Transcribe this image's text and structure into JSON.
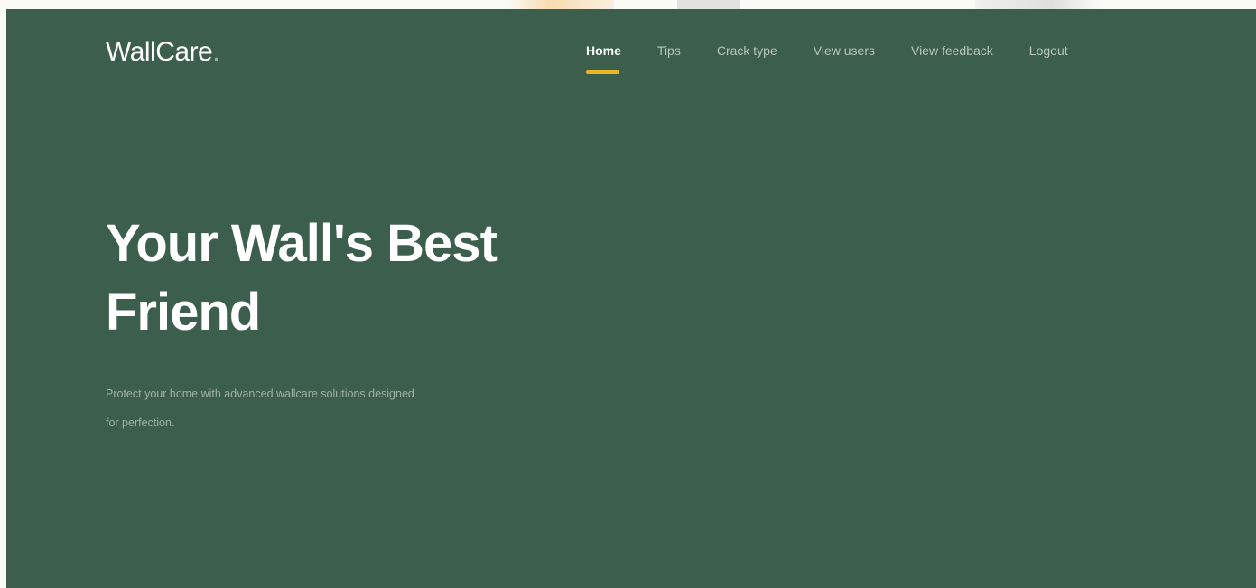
{
  "brand": {
    "name": "WallCare",
    "dot": "."
  },
  "nav": {
    "items": [
      {
        "label": "Home",
        "active": true
      },
      {
        "label": "Tips",
        "active": false
      },
      {
        "label": "Crack type",
        "active": false
      },
      {
        "label": "View users",
        "active": false
      },
      {
        "label": "View feedback",
        "active": false
      },
      {
        "label": "Logout",
        "active": false
      }
    ]
  },
  "hero": {
    "headline_line1": "Your Wall's Best",
    "headline_line2": "Friend",
    "subtitle_line1": "Protect your home with advanced wallcare solutions designed",
    "subtitle_line2": "for perfection."
  },
  "colors": {
    "hero_background": "#3c5e4c",
    "accent": "#e9b62a",
    "text_primary": "#ffffff",
    "text_muted": "#b8c6be"
  }
}
